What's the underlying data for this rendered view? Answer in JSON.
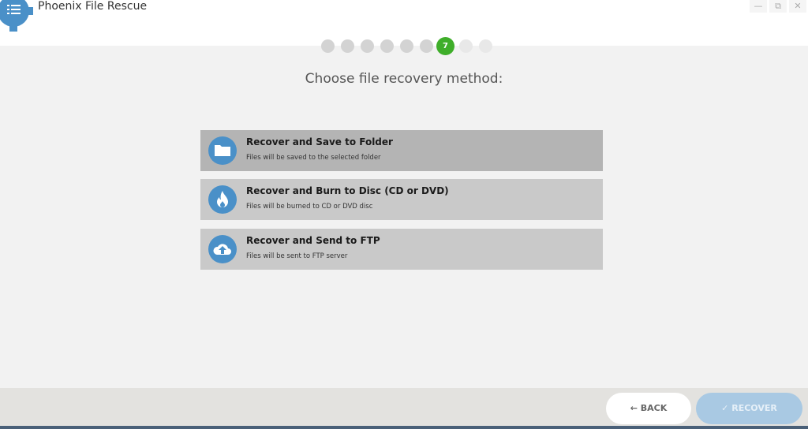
{
  "app": {
    "title": "Phoenix File Rescue",
    "window_controls": [
      "minimize",
      "restore",
      "close"
    ]
  },
  "steps": {
    "total": 9,
    "current": 7,
    "current_label": "7"
  },
  "heading": "Choose file recovery method:",
  "options": [
    {
      "title": "Recover and Save to Folder",
      "subtitle": "Files will be saved to the selected folder",
      "icon": "folder-icon",
      "selected": true
    },
    {
      "title": "Recover and Burn to Disc (CD or DVD)",
      "subtitle": "Files will be burned to CD or DVD disc",
      "icon": "flame-icon",
      "selected": false
    },
    {
      "title": "Recover and Send to FTP",
      "subtitle": "Files will be sent to FTP server",
      "icon": "cloud-upload-icon",
      "selected": false
    }
  ],
  "footer": {
    "back_label": "BACK",
    "recover_label": "RECOVER"
  },
  "colors": {
    "accent": "#4a90c8",
    "active_step": "#3fae2a",
    "recover_disabled": "#a9c9e3"
  }
}
